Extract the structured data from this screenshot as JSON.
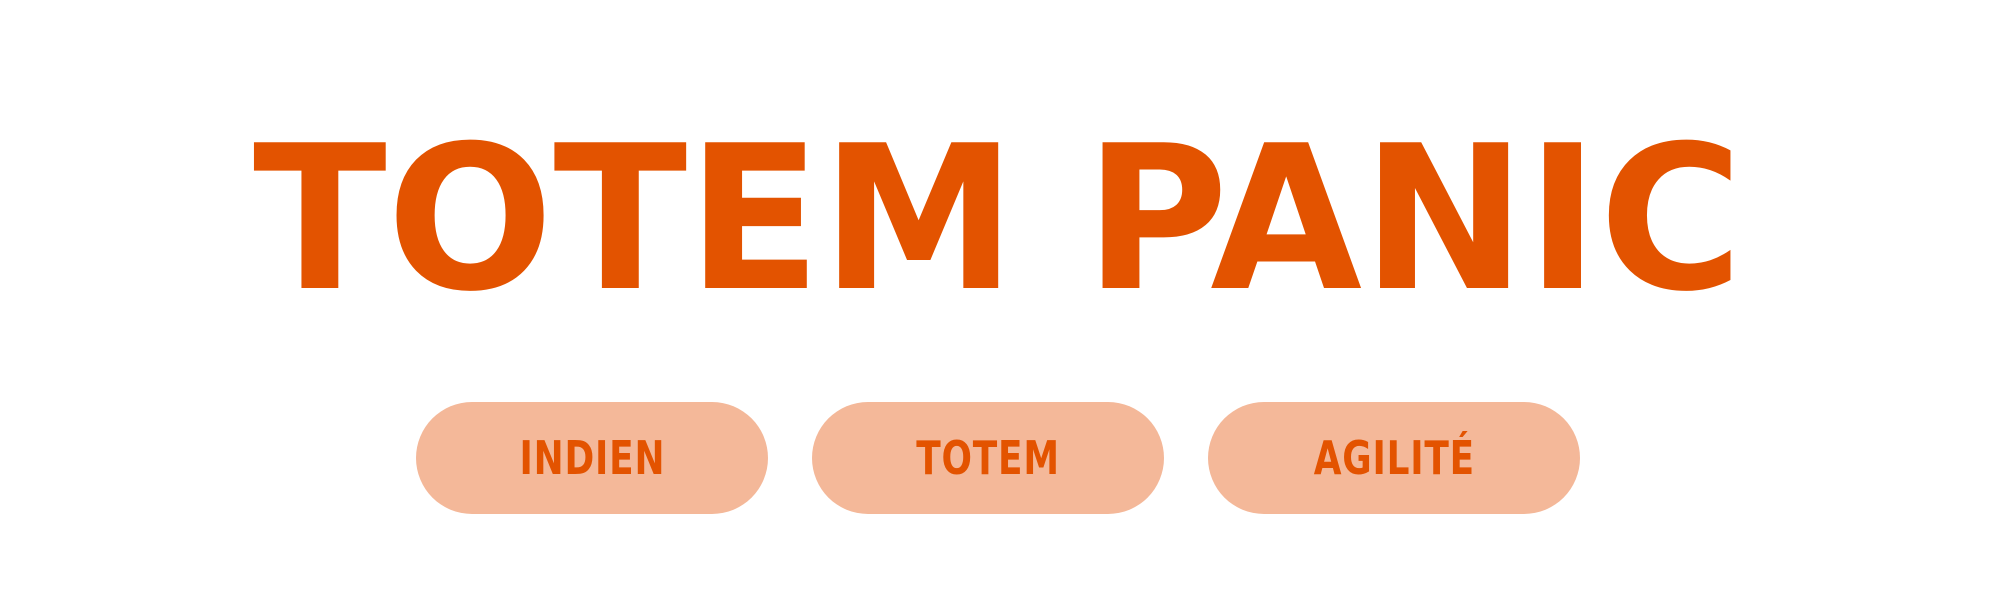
{
  "title": "TOTEM PANIC",
  "tags": [
    {
      "label": "INDIEN"
    },
    {
      "label": "TOTEM"
    },
    {
      "label": "AGILITÉ"
    }
  ],
  "colors": {
    "primary": "#E35300",
    "tag_background": "#F4B899",
    "background": "#FFFFFF"
  }
}
